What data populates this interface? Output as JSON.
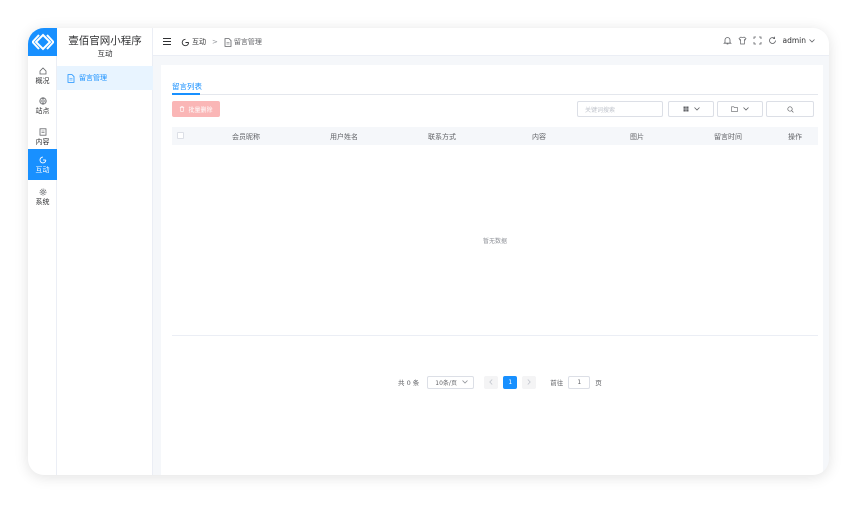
{
  "nav": {
    "items": [
      {
        "label": "概况",
        "icon": "home-icon"
      },
      {
        "label": "站点",
        "icon": "globe-icon"
      },
      {
        "label": "内容",
        "icon": "document-icon"
      },
      {
        "label": "互动",
        "icon": "chat-icon",
        "active": true
      },
      {
        "label": "系统",
        "icon": "gear-icon"
      }
    ]
  },
  "sidebar": {
    "app_name": "壹佰官网小程序",
    "section": "互动",
    "items": [
      {
        "label": "留言管理",
        "icon": "file-icon",
        "active": true
      }
    ]
  },
  "header": {
    "breadcrumb": [
      "互动",
      "留言管理"
    ],
    "breadcrumb_separator": ">",
    "user": "admin"
  },
  "main": {
    "tab": "留言列表",
    "batch_delete_label": "批量删除",
    "search_placeholder": "关键词搜索",
    "columns": [
      "会员昵称",
      "用户姓名",
      "联系方式",
      "内容",
      "图片",
      "留言时间",
      "操作"
    ],
    "empty_text": "暂无数据"
  },
  "pagination": {
    "total_text": "共 0 条",
    "page_size": "10条/页",
    "current_page": "1",
    "goto_label": "前往",
    "goto_value": "1",
    "page_suffix": "页"
  },
  "colors": {
    "accent": "#1890ff",
    "danger_disabled": "#fab6b6",
    "active_bg": "#e8f4ff"
  }
}
